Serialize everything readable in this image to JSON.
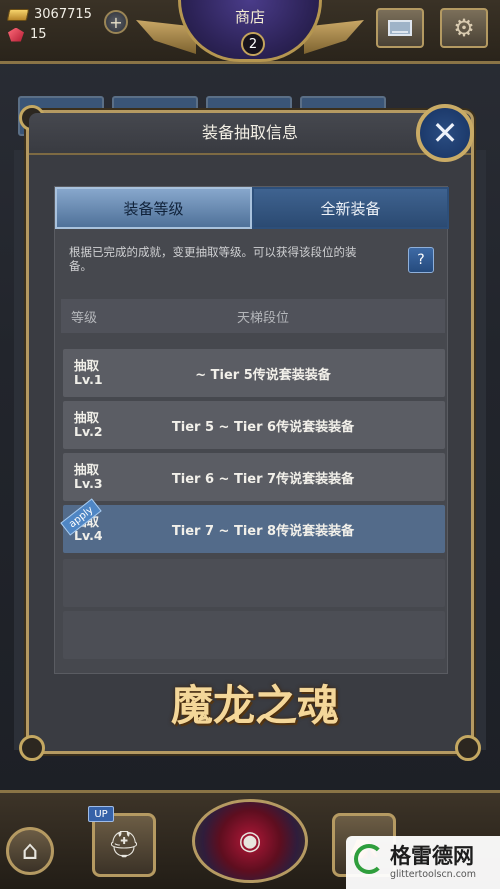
{
  "topbar": {
    "gold_amount": "3067715",
    "gem_amount": "15",
    "plus_label": "+",
    "shop_title": "商店",
    "shop_badge": "2",
    "icons": {
      "gold": "gold-bars-icon",
      "gem": "ruby-gem-icon",
      "mail": "mail-icon",
      "settings": "gear-icon"
    }
  },
  "modal": {
    "title": "装备抽取信息",
    "close_label": "✕",
    "tabs": [
      {
        "label": "装备等级",
        "active": true
      },
      {
        "label": "全新装备",
        "active": false
      }
    ],
    "info_text": "根据已完成的成就，变更抽取等级。可以获得该段位的装备。",
    "help_label": "?",
    "table_headers": {
      "level": "等级",
      "tier": "天梯段位"
    },
    "rows": [
      {
        "level_line1": "抽取",
        "level_line2": "Lv.1",
        "range": "~ Tier 5传说套装装备",
        "applied": false
      },
      {
        "level_line1": "抽取",
        "level_line2": "Lv.2",
        "range": "Tier 5 ~ Tier 6传说套装装备",
        "applied": false
      },
      {
        "level_line1": "抽取",
        "level_line2": "Lv.3",
        "range": "Tier 6 ~ Tier 7传说套装装备",
        "applied": false
      },
      {
        "level_line1": "抽取",
        "level_line2": "Lv.4",
        "range": "Tier 7 ~ Tier 8传说套装装备",
        "applied": true
      }
    ],
    "apply_tag": "apply"
  },
  "logo_text": "魔龙之魂",
  "bottombar": {
    "up_badge": "UP"
  },
  "watermark": {
    "title": "格雷德网",
    "subtitle": "glittertoolscn.com"
  },
  "colors": {
    "accent_gold": "#b59a62",
    "tab_blue": "#4f7199",
    "applied_row": "#536b8a"
  }
}
